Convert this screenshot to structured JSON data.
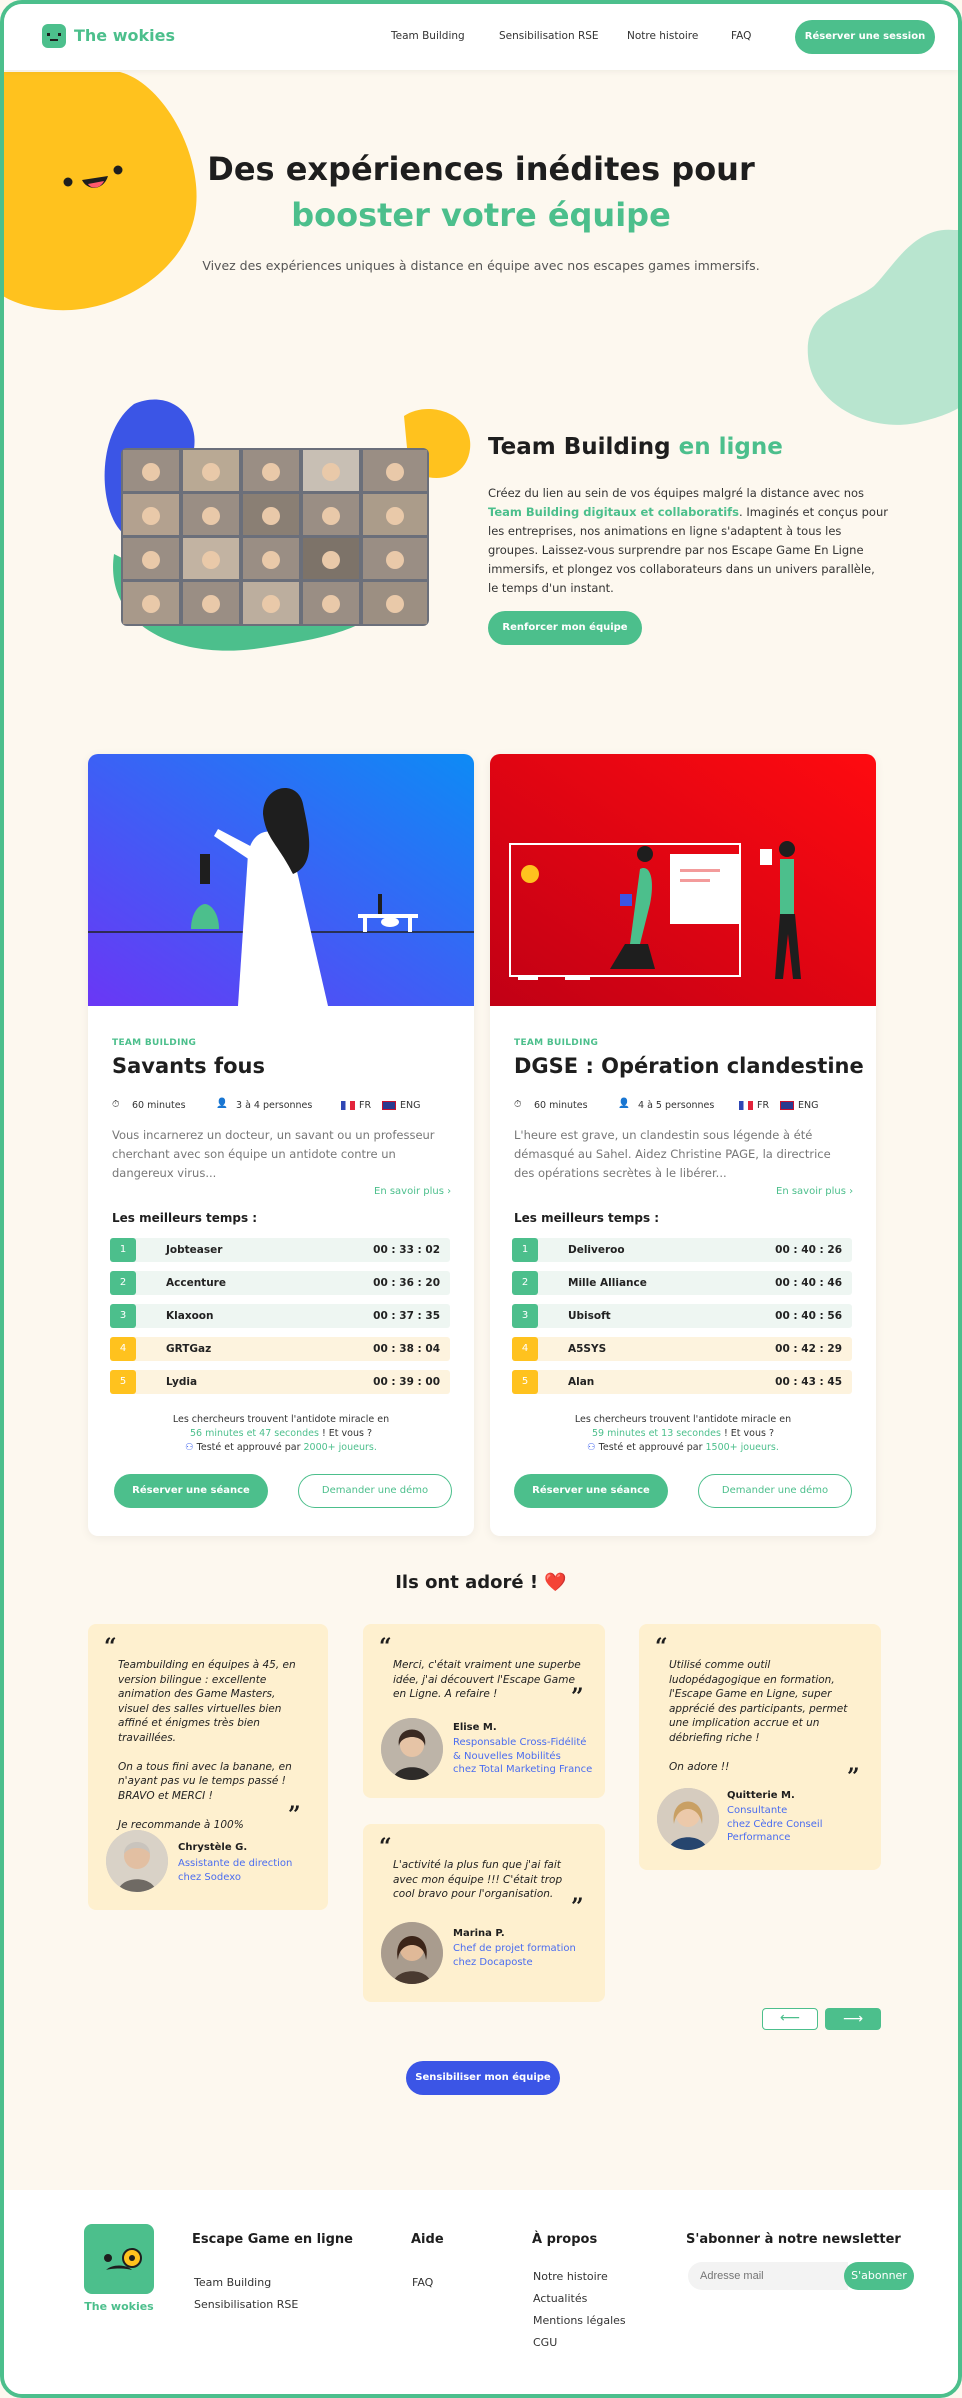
{
  "header": {
    "logo": "The wokies",
    "nav": [
      "Team Building",
      "Sensibilisation RSE",
      "Notre histoire",
      "FAQ"
    ],
    "cta": "Réserver une session"
  },
  "hero": {
    "title_line1": "Des expériences inédites pour",
    "title_line2": "booster votre équipe",
    "subtitle": "Vivez des expériences uniques à distance en équipe avec nos escapes games immersifs."
  },
  "team": {
    "title_main": "Team Building",
    "title_accent": "en ligne",
    "text_1": "Créez du lien au sein de vos équipes malgré la distance avec nos",
    "text_link": "Team Building digitaux et collaboratifs",
    "text_2": ". Imaginés et conçus pour les entreprises, nos animations en ligne s'adaptent à tous les groupes. Laissez-vous surprendre par nos Escape Game En Ligne immersifs, et plongez vos collaborateurs dans un univers parallèle, le temps d'un instant.",
    "cta": "Renforcer mon équipe"
  },
  "cards": [
    {
      "tag": "TEAM BUILDING",
      "title": "Savants fous",
      "duration": "60 minutes",
      "people": "3 à 4 personnes",
      "lang_fr": "FR",
      "lang_en": "ENG",
      "desc": "Vous incarnerez un docteur, un savant ou un professeur cherchant avec son équipe un antidote contre un dangereux virus...",
      "more": "En savoir plus ›",
      "best_title": "Les meilleurs temps :",
      "ranking": [
        {
          "rank": "1",
          "name": "Jobteaser",
          "time": "00 : 33 : 02"
        },
        {
          "rank": "2",
          "name": "Accenture",
          "time": "00 : 36 : 20"
        },
        {
          "rank": "3",
          "name": "Klaxoon",
          "time": "00 : 37 : 35"
        },
        {
          "rank": "4",
          "name": "GRTGaz",
          "time": "00 : 38 : 04"
        },
        {
          "rank": "5",
          "name": "Lydia",
          "time": "00 : 39 : 00"
        }
      ],
      "note_1": "Les chercheurs trouvent l'antidote miracle en",
      "note_time": "56 minutes et 47 secondes",
      "note_2": " ! Et vous ?",
      "tested": "Testé et approuvé par ",
      "tested_count": "2000+ joueurs.",
      "cta_book": "Réserver une séance",
      "cta_demo": "Demander une démo"
    },
    {
      "tag": "TEAM BUILDING",
      "title": "DGSE : Opération clandestine",
      "duration": "60 minutes",
      "people": "4 à 5 personnes",
      "lang_fr": "FR",
      "lang_en": "ENG",
      "desc": "L'heure est grave, un clandestin sous légende à été démasqué au Sahel. Aidez Christine PAGE, la directrice des opérations secrètes à le libérer...",
      "more": "En savoir plus ›",
      "best_title": "Les meilleurs temps :",
      "ranking": [
        {
          "rank": "1",
          "name": "Deliveroo",
          "time": "00 : 40 : 26"
        },
        {
          "rank": "2",
          "name": "Mille Alliance",
          "time": "00 : 40 : 46"
        },
        {
          "rank": "3",
          "name": "Ubisoft",
          "time": "00 : 40 : 56"
        },
        {
          "rank": "4",
          "name": "A5SYS",
          "time": "00 : 42 : 29"
        },
        {
          "rank": "5",
          "name": "Alan",
          "time": "00 : 43 : 45"
        }
      ],
      "note_1": "Les chercheurs trouvent l'antidote miracle en",
      "note_time": "59 minutes et 13 secondes",
      "note_2": " ! Et vous ?",
      "tested": "Testé et approuvé par ",
      "tested_count": "1500+ joueurs.",
      "cta_book": "Réserver une séance",
      "cta_demo": "Demander une démo"
    }
  ],
  "testimonials": {
    "title": "Ils ont adoré ! ❤️",
    "items": [
      {
        "quote": "Teambuilding en équipes à 45, en version bilingue : excellente animation des Game Masters, visuel des salles virtuelles bien affiné et énigmes très bien travaillées.\n\nOn a tous fini avec la banane, en n'ayant pas vu le temps passé ! BRAVO et MERCI !\n\nJe recommande à 100%",
        "name": "Chrystèle G.",
        "role": "Assistante de direction\nchez Sodexo"
      },
      {
        "quote": "Merci, c'était vraiment une superbe idée, j'ai découvert l'Escape Game en Ligne. A refaire !",
        "name": "Elise M.",
        "role": "Responsable Cross-Fidélité\n& Nouvelles Mobilités\nchez Total Marketing France"
      },
      {
        "quote": "L'activité la plus fun que j'ai fait avec mon équipe !!! C'était trop cool bravo pour l'organisation.",
        "name": "Marina P.",
        "role": "Chef de projet formation\nchez Docaposte"
      },
      {
        "quote": "Utilisé comme outil ludopédagogique en formation, l'Escape Game en Ligne, super apprécié des participants, permet une implication accrue et un débriefing riche !\n\nOn adore !!",
        "name": "Quitterie M.",
        "role": "Consultante\nchez Cèdre Conseil\nPerformance"
      }
    ],
    "cta": "Sensibiliser mon équipe"
  },
  "footer": {
    "logo": "The wokies",
    "col1_title": "Escape Game en ligne",
    "col1_links": [
      "Team Building",
      "Sensibilisation RSE"
    ],
    "col2_title": "Aide",
    "col2_links": [
      "FAQ"
    ],
    "col3_title": "À propos",
    "col3_links": [
      "Notre histoire",
      "Actualités",
      "Mentions légales",
      "CGU"
    ],
    "newsletter_title": "S'abonner à notre newsletter",
    "newsletter_placeholder": "Adresse mail",
    "newsletter_cta": "S'abonner"
  },
  "colors": {
    "green": "#4cbf8c",
    "yellow": "#ffc21e",
    "blue": "#3b55e6",
    "red": "#e1001a",
    "cream": "#fdf8ef"
  }
}
